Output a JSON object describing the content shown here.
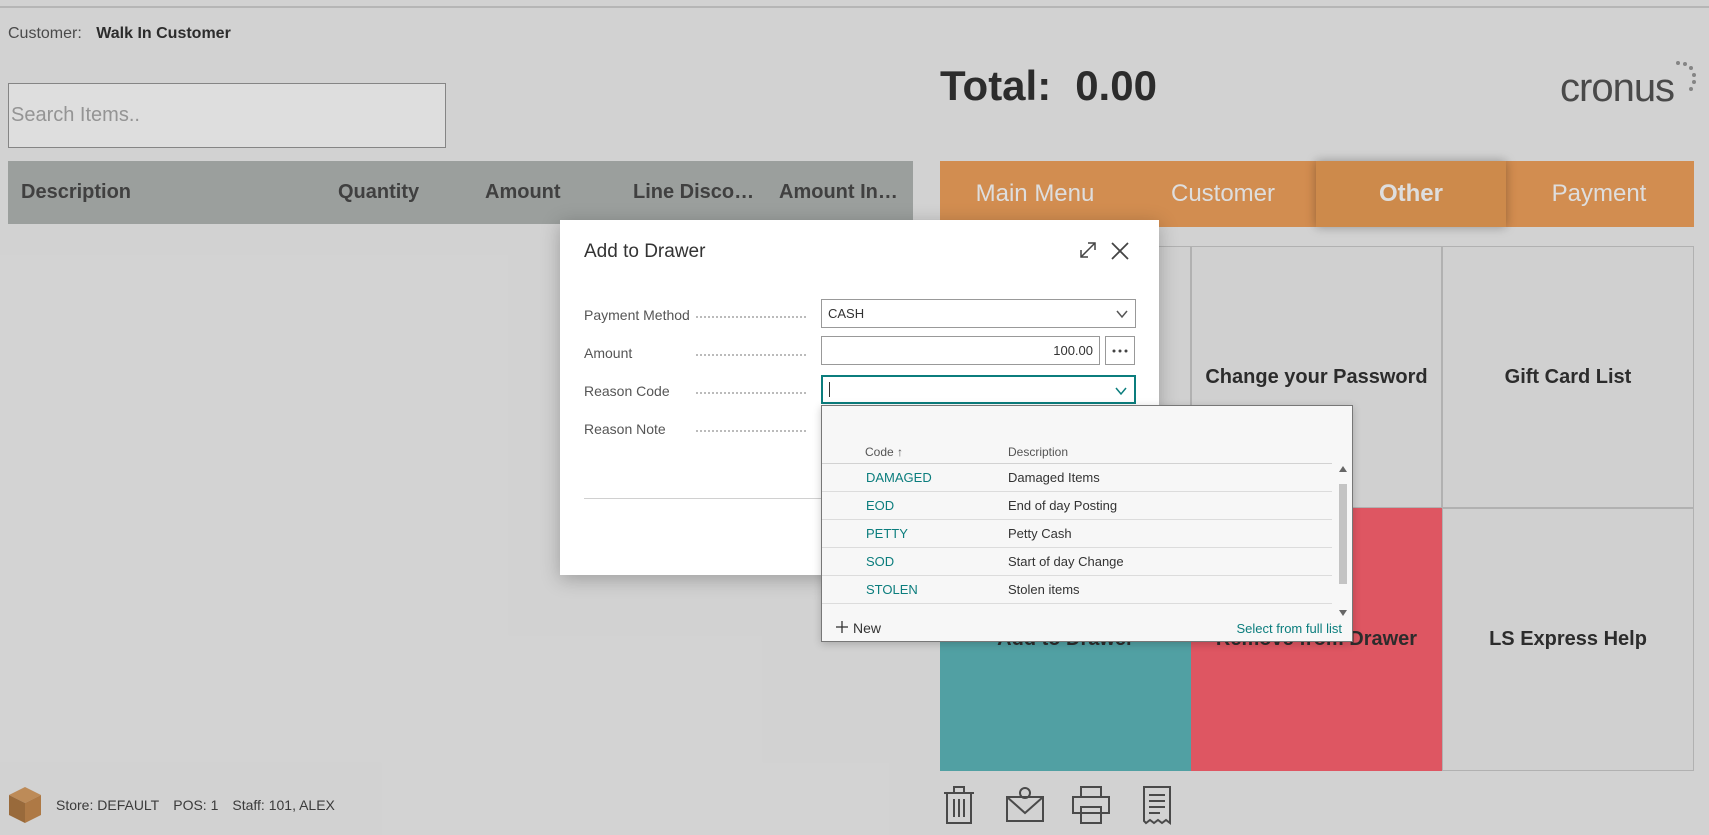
{
  "customer": {
    "label": "Customer:",
    "name": "Walk In Customer"
  },
  "search": {
    "placeholder": "Search Items.."
  },
  "lines_columns": [
    "Description",
    "Quantity",
    "Amount",
    "Line Disco…",
    "Amount In…"
  ],
  "total": {
    "label": "Total:",
    "value": "0.00"
  },
  "logo": {
    "text": "cronus"
  },
  "tabs": [
    {
      "label": "Main Menu",
      "active": false
    },
    {
      "label": "Customer",
      "active": false
    },
    {
      "label": "Other",
      "active": true
    },
    {
      "label": "Payment",
      "active": false
    }
  ],
  "tiles": [
    {
      "label": "",
      "color": ""
    },
    {
      "label": "Change your Password",
      "color": ""
    },
    {
      "label": "Gift Card List",
      "color": ""
    },
    {
      "label": "Add to Drawer",
      "color": "#5eb8bc"
    },
    {
      "label": "Remove from Drawer",
      "color": "#ff6371"
    },
    {
      "label": "LS Express Help",
      "color": ""
    }
  ],
  "bottom_icons": [
    "trash-icon",
    "email-icon",
    "printer-icon",
    "receipt-icon"
  ],
  "store_bar": {
    "store_label": "Store:",
    "store": "DEFAULT",
    "pos_label": "POS:",
    "pos": "1",
    "staff_label": "Staff:",
    "staff": "101, ALEX"
  },
  "dialog": {
    "title": "Add to Drawer",
    "fields": {
      "payment_method": {
        "label": "Payment Method",
        "value": "CASH"
      },
      "amount": {
        "label": "Amount",
        "value": "100.00"
      },
      "reason_code": {
        "label": "Reason Code",
        "value": ""
      },
      "reason_note": {
        "label": "Reason Note"
      }
    }
  },
  "reason_dropdown": {
    "columns": {
      "code": "Code ↑",
      "description": "Description"
    },
    "rows": [
      {
        "code": "DAMAGED",
        "description": "Damaged Items"
      },
      {
        "code": "EOD",
        "description": "End of day Posting"
      },
      {
        "code": "PETTY",
        "description": "Petty Cash"
      },
      {
        "code": "SOD",
        "description": "Start of day Change"
      },
      {
        "code": "STOLEN",
        "description": "Stolen items"
      }
    ],
    "new_label": "New",
    "full_list_label": "Select from full list"
  },
  "colors": {
    "accent": "#0b7d7d",
    "tab_bar": "#f2a25c",
    "teal_tile": "#5eb8bc",
    "red_tile": "#ff6371"
  }
}
